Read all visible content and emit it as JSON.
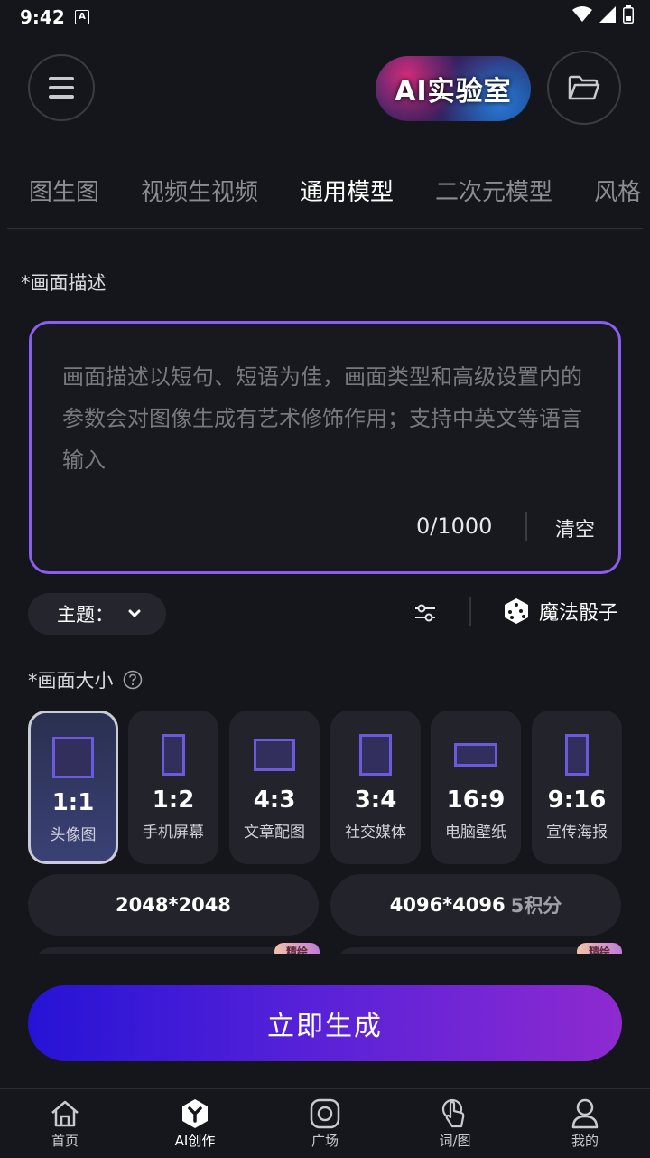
{
  "status": {
    "time": "9:42",
    "notif_letter": "A"
  },
  "header": {
    "menu_icon": "hamburger-icon",
    "lab_title": "AI实验室",
    "folder_icon": "folder-icon"
  },
  "tabs": [
    {
      "label": "图生图"
    },
    {
      "label": "视频生视频"
    },
    {
      "label": "通用模型",
      "active": true
    },
    {
      "label": "二次元模型"
    },
    {
      "label": "风格"
    }
  ],
  "prompt": {
    "label": "*画面描述",
    "placeholder": "画面描述以短句、短语为佳，画面类型和高级设置内的参数会对图像生成有艺术修饰作用；支持中英文等语言输入",
    "counter": "0/1000",
    "clear_label": "清空"
  },
  "theme": {
    "label": "主题："
  },
  "magic_dice": {
    "label": "魔法骰子"
  },
  "size": {
    "label": "*画面大小",
    "options": [
      {
        "ratio": "1:1",
        "name": "头像图",
        "selected": true
      },
      {
        "ratio": "1:2",
        "name": "手机屏幕"
      },
      {
        "ratio": "4:3",
        "name": "文章配图"
      },
      {
        "ratio": "3:4",
        "name": "社交媒体"
      },
      {
        "ratio": "16:9",
        "name": "电脑壁纸"
      },
      {
        "ratio": "9:16",
        "name": "宣传海报"
      }
    ]
  },
  "resolution": {
    "options": [
      {
        "label": "2048*2048",
        "cost": ""
      },
      {
        "label": "4096*4096",
        "cost": "5积分"
      }
    ],
    "badge": "精绘"
  },
  "generate_label": "立即生成",
  "nav": [
    {
      "label": "首页",
      "icon": "home-icon"
    },
    {
      "label": "AI创作",
      "icon": "ai-create-icon",
      "active": true
    },
    {
      "label": "广场",
      "icon": "square-icon"
    },
    {
      "label": "词/图",
      "icon": "touch-icon"
    },
    {
      "label": "我的",
      "icon": "user-icon"
    }
  ],
  "colors": {
    "accent": "#8a5ef0",
    "background": "#15161b",
    "generate_start": "#2613d6",
    "generate_end": "#8e2ad0"
  }
}
